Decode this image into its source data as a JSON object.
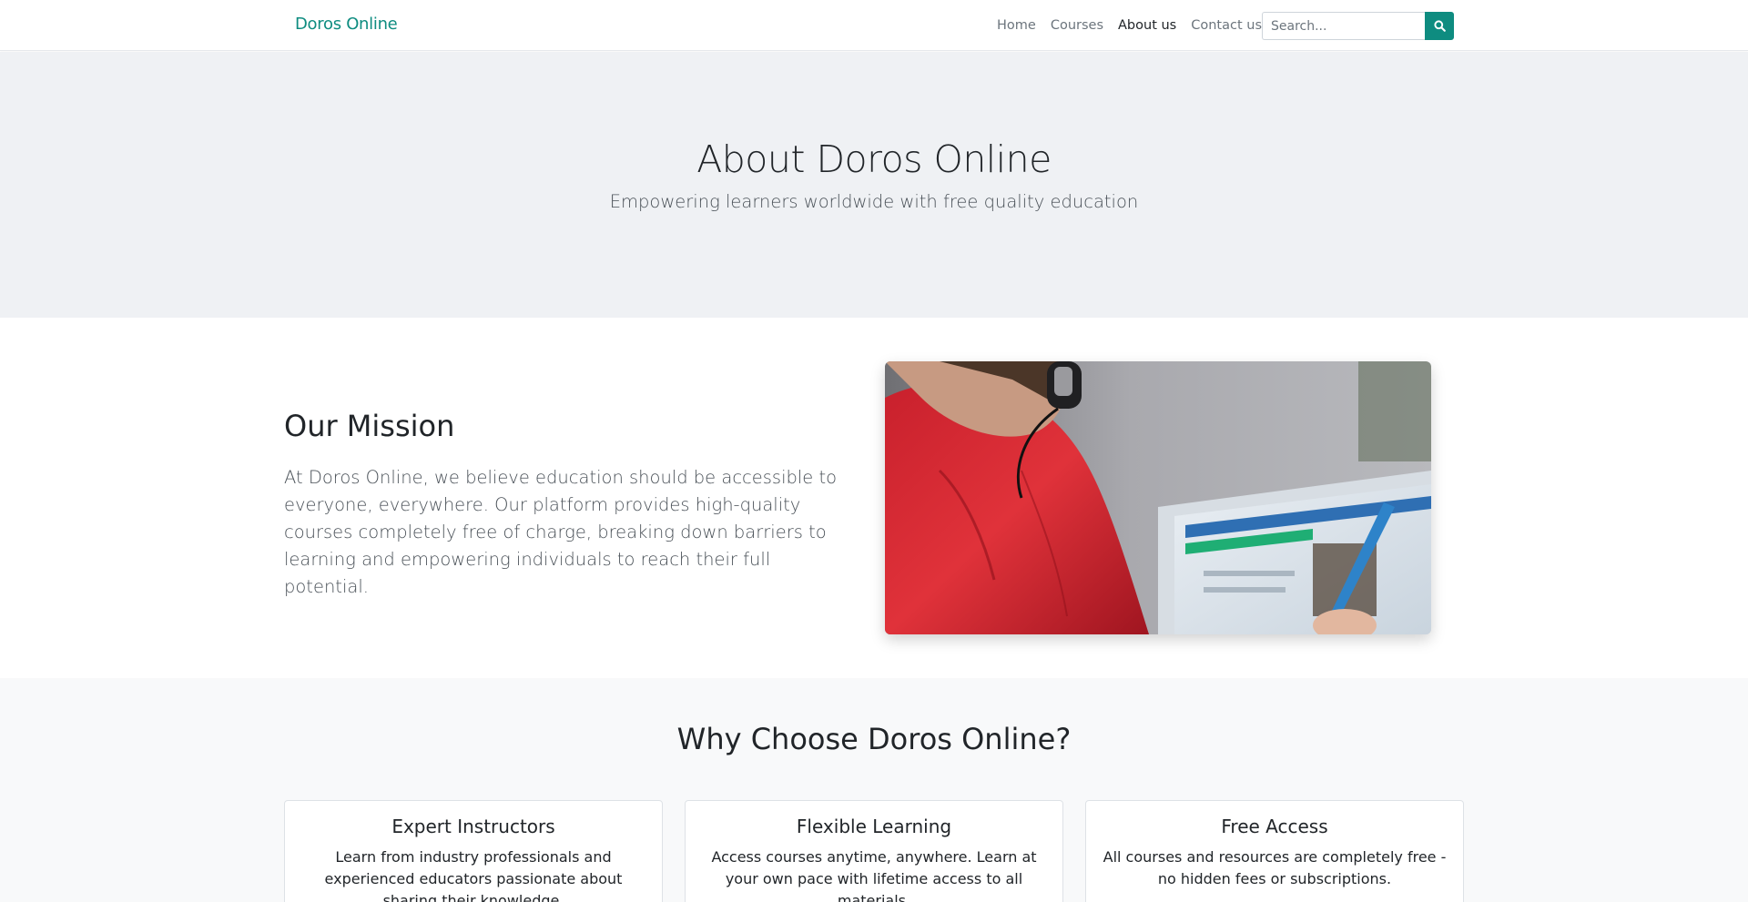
{
  "navbar": {
    "brand": "Doros Online",
    "links": [
      {
        "label": "Home",
        "active": false
      },
      {
        "label": "Courses",
        "active": false
      },
      {
        "label": "About us",
        "active": true
      },
      {
        "label": "Contact us",
        "active": false
      }
    ],
    "search": {
      "placeholder": "Search...",
      "value": "",
      "button_icon": "search-icon"
    }
  },
  "hero": {
    "title": "About Doros Online",
    "subtitle": "Empowering learners worldwide with free quality education"
  },
  "mission": {
    "title": "Our Mission",
    "text": "At Doros Online, we believe education should be accessible to everyone, everywhere. Our platform provides high-quality courses completely free of charge, breaking down barriers to learning and empowering individuals to reach their full potential."
  },
  "why": {
    "title": "Why Choose Doros Online?",
    "cards": [
      {
        "title": "Expert Instructors",
        "text": "Learn from industry professionals and experienced educators passionate about sharing their knowledge."
      },
      {
        "title": "Flexible Learning",
        "text": "Access courses anytime, anywhere. Learn at your own pace with lifetime access to all materials."
      },
      {
        "title": "Free Access",
        "text": "All courses and resources are completely free - no hidden fees or subscriptions."
      }
    ]
  },
  "colors": {
    "brand": "#0e8c80",
    "hero_bg": "#eff1f4",
    "section_bg": "#f8f9fa"
  }
}
